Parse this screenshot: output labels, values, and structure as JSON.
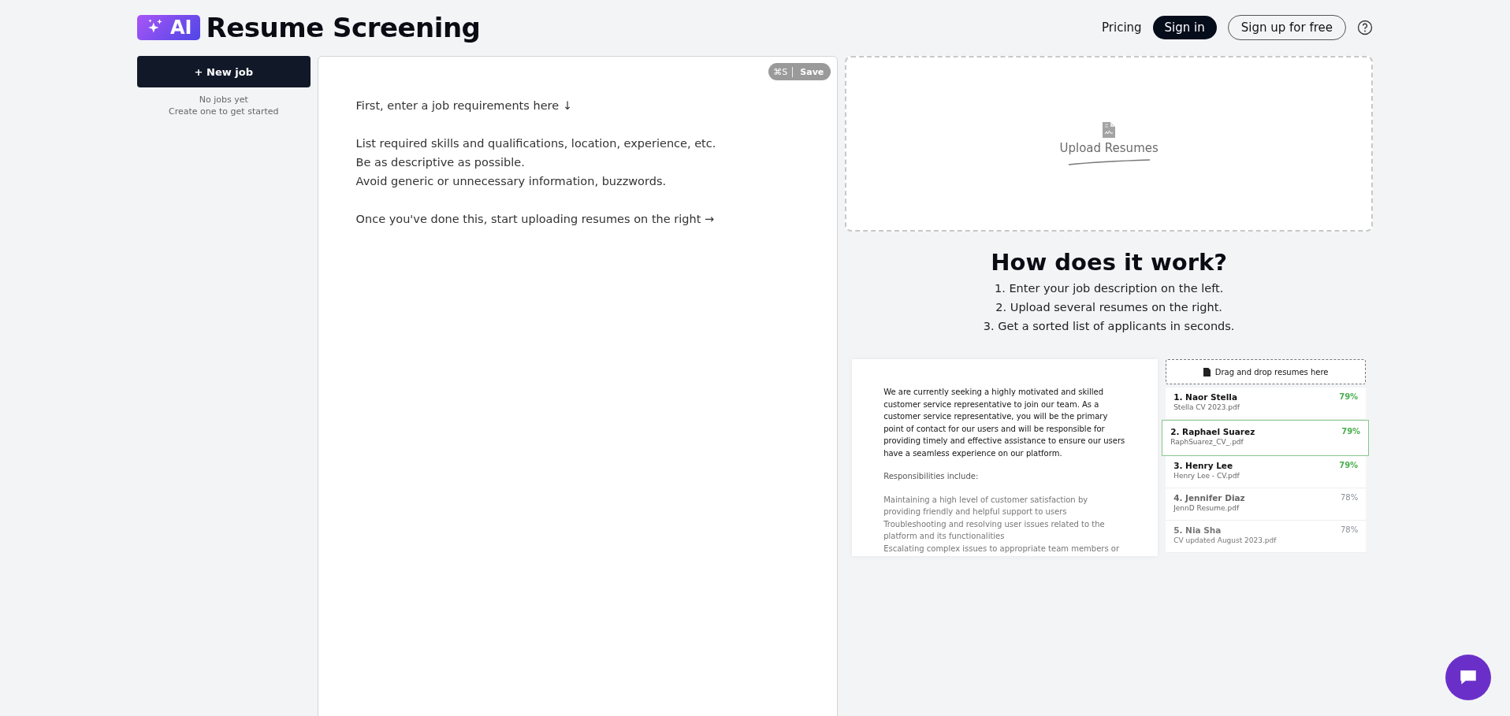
{
  "header": {
    "logo_badge": "AI",
    "title": "Resume Screening",
    "nav": [
      {
        "label": "Pricing",
        "kind": "link"
      },
      {
        "label": "Sign in",
        "kind": "primary"
      },
      {
        "label": "Sign up for free",
        "kind": "outline"
      }
    ]
  },
  "sidebar": {
    "new_job_button": "+ New job",
    "empty_title": "No jobs yet",
    "empty_hint": "Create one to get started"
  },
  "editor": {
    "shortcut": "⌘S",
    "save_label": "Save",
    "placeholder": "First, enter a job requirements here ↓\n\nList required skills and qualifications, location, experience, etc.\nBe as descriptive as possible.\nAvoid generic or unnecessary information, buzzwords.\n\nOnce you've done this, start uploading resumes on the right →"
  },
  "upload": {
    "label": "Upload Resumes"
  },
  "how_it_works": {
    "title": "How does it work?",
    "steps": [
      "1. Enter your job description on the left.",
      "2. Upload several resumes on the right.",
      "3. Get a sorted list of applicants in seconds."
    ]
  },
  "preview": {
    "description": [
      "We are currently seeking a highly motivated and skilled customer service representative to join our team. As a customer service representative, you will be the primary point of contact for our users and will be responsible for providing timely and effective assistance to ensure our users have a seamless experience on our platform.",
      "Responsibilities include:",
      "Maintaining a high level of customer satisfaction by providing friendly and helpful support to users\nTroubleshooting and resolving user issues related to the platform and its functionalities\nEscalating complex issues to appropriate team members or"
    ],
    "dropzone": "Drag and drop resumes here",
    "applicants": [
      {
        "name": "1. Naor Stella",
        "file": "Stella CV 2023.pdf",
        "score": "79%",
        "color": "#4caf50",
        "selected": false
      },
      {
        "name": "2. Raphael Suarez",
        "file": "RaphSuarez_CV_.pdf",
        "score": "79%",
        "color": "#4caf50",
        "selected": true
      },
      {
        "name": "3. Henry Lee",
        "file": "Henry Lee - CV.pdf",
        "score": "79%",
        "color": "#4caf50",
        "selected": false
      },
      {
        "name": "4. Jennifer Diaz",
        "file": "JennD Resume.pdf",
        "score": "78%",
        "color": "#8a8f98",
        "selected": false
      },
      {
        "name": "5. Nia Sha",
        "file": "CV updated August 2023.pdf",
        "score": "78%",
        "color": "#8a8f98",
        "selected": false
      }
    ]
  }
}
